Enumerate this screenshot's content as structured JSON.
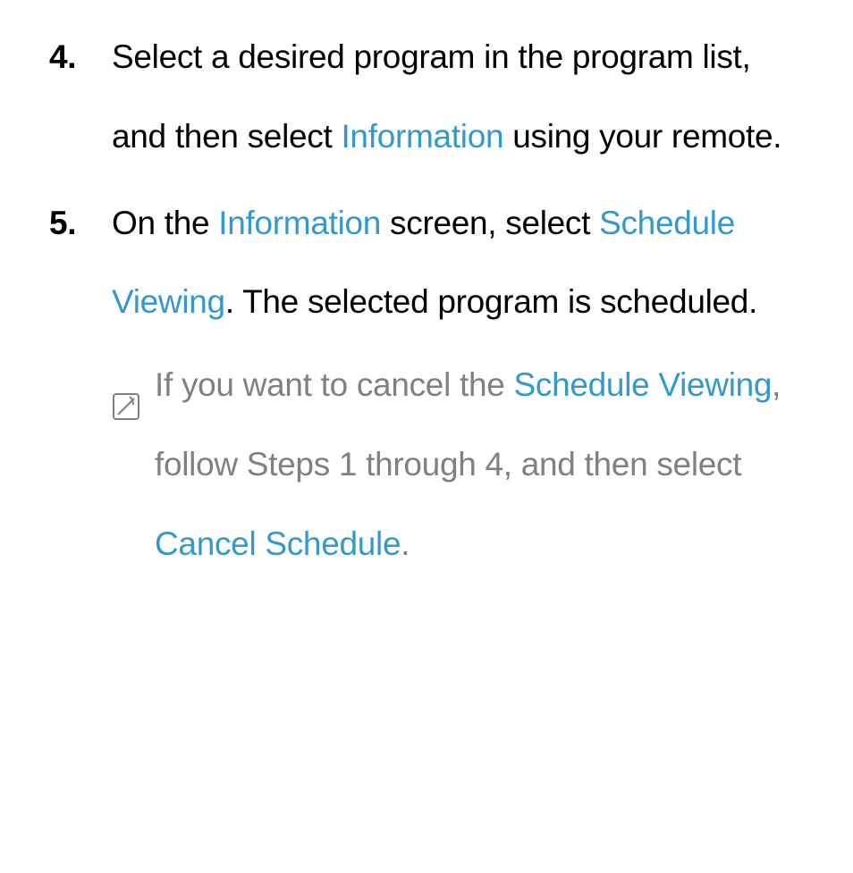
{
  "steps": [
    {
      "number": "4.",
      "parts": [
        {
          "text": "Select a desired program in the program list, and then select ",
          "highlight": false
        },
        {
          "text": "Information",
          "highlight": true
        },
        {
          "text": " using your remote.",
          "highlight": false
        }
      ]
    },
    {
      "number": "5.",
      "parts": [
        {
          "text": "On the ",
          "highlight": false
        },
        {
          "text": "Information",
          "highlight": true
        },
        {
          "text": " screen, select ",
          "highlight": false
        },
        {
          "text": "Schedule Viewing",
          "highlight": true
        },
        {
          "text": ". The selected program is scheduled.",
          "highlight": false
        }
      ]
    }
  ],
  "note": {
    "parts": [
      {
        "text": "If you want to cancel the ",
        "highlight": false
      },
      {
        "text": "Schedule Viewing",
        "highlight": true
      },
      {
        "text": ", follow Steps 1 through 4, and then select ",
        "highlight": false
      },
      {
        "text": "Cancel Schedule",
        "highlight": true
      },
      {
        "text": ".",
        "highlight": false
      }
    ]
  }
}
